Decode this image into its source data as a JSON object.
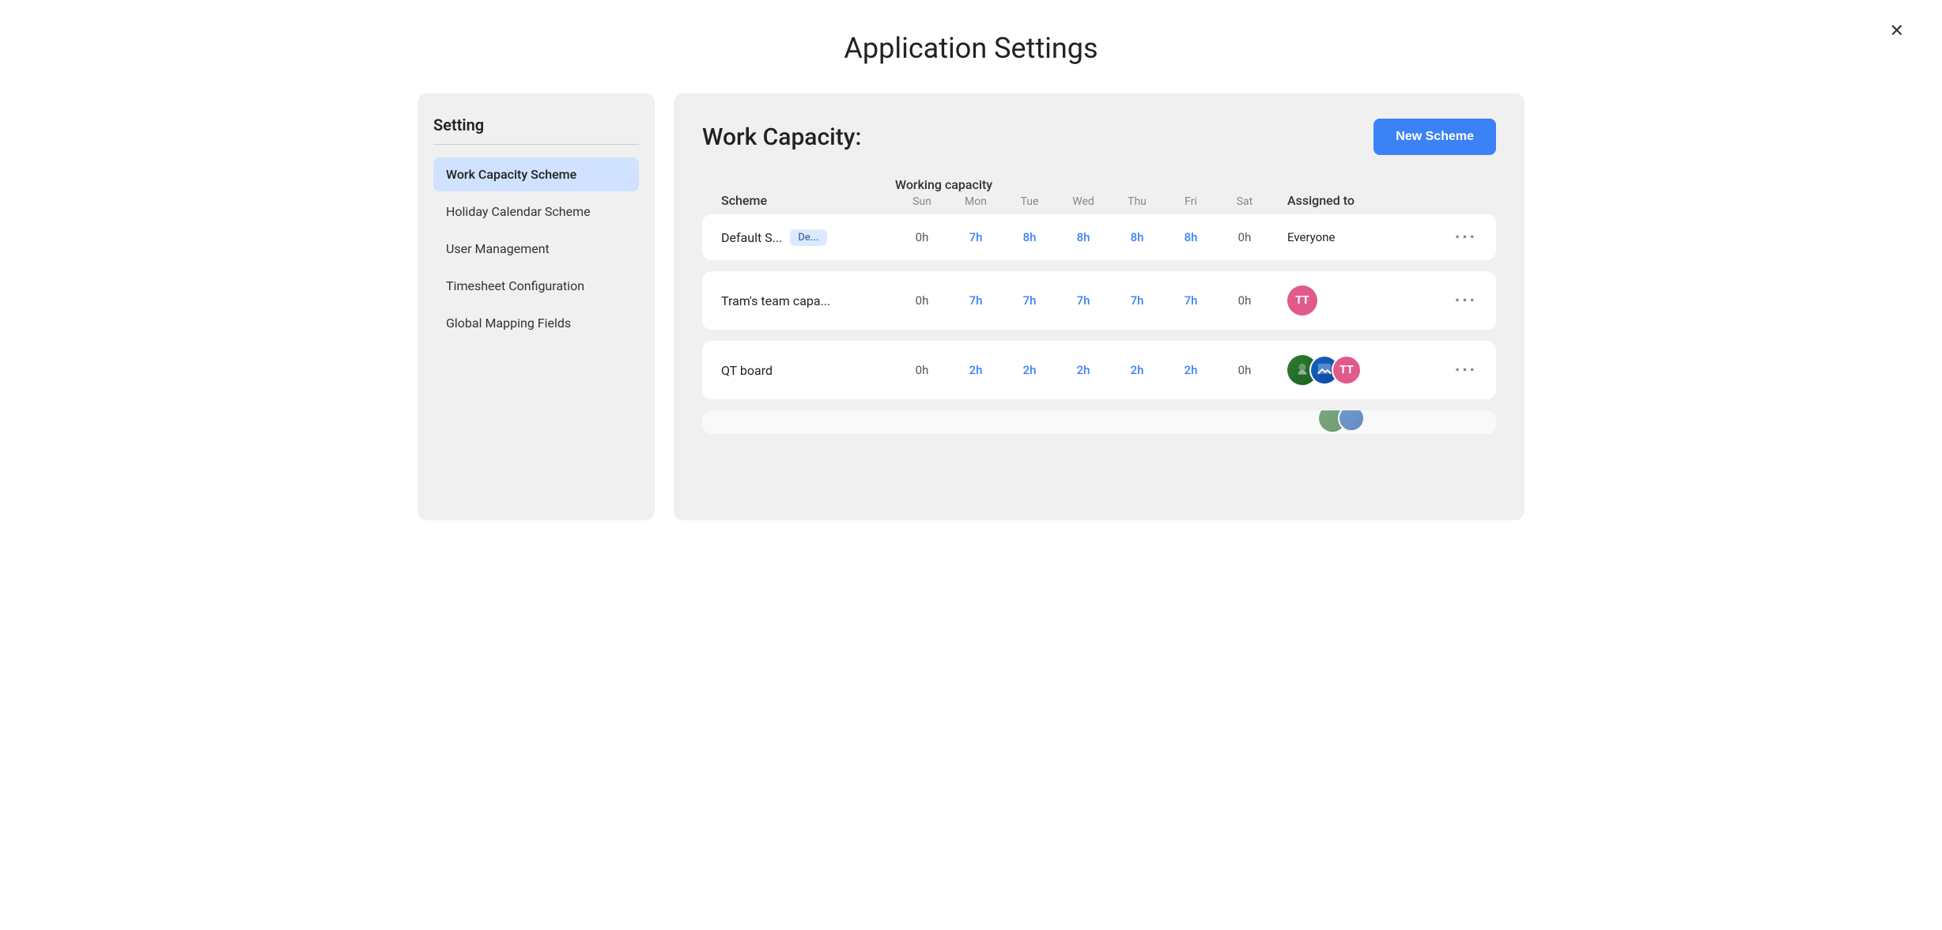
{
  "page": {
    "title": "Application Settings"
  },
  "close_button": "✕",
  "sidebar": {
    "title": "Setting",
    "items": [
      {
        "id": "work-capacity-scheme",
        "label": "Work Capacity Scheme",
        "active": true
      },
      {
        "id": "holiday-calendar-scheme",
        "label": "Holiday Calendar Scheme",
        "active": false
      },
      {
        "id": "user-management",
        "label": "User Management",
        "active": false
      },
      {
        "id": "timesheet-configuration",
        "label": "Timesheet Configuration",
        "active": false
      },
      {
        "id": "global-mapping-fields",
        "label": "Global Mapping Fields",
        "active": false
      }
    ]
  },
  "content": {
    "title": "Work Capacity:",
    "new_scheme_label": "New Scheme",
    "table": {
      "headers": {
        "scheme": "Scheme",
        "working_capacity": "Working capacity",
        "days": [
          "Sun",
          "Mon",
          "Tue",
          "Wed",
          "Thu",
          "Fri",
          "Sat"
        ],
        "assigned_to": "Assigned to"
      },
      "rows": [
        {
          "name": "Default S...",
          "badge": "De...",
          "values": [
            "0h",
            "7h",
            "8h",
            "8h",
            "8h",
            "8h",
            "0h"
          ],
          "zero_indices": [
            0,
            6
          ],
          "assigned_text": "Everyone",
          "avatars": []
        },
        {
          "name": "Tram's team capa...",
          "badge": null,
          "values": [
            "0h",
            "7h",
            "7h",
            "7h",
            "7h",
            "7h",
            "0h"
          ],
          "zero_indices": [
            0,
            6
          ],
          "assigned_text": "",
          "avatars": [
            {
              "type": "tt",
              "label": "TT"
            }
          ]
        },
        {
          "name": "QT board",
          "badge": null,
          "values": [
            "0h",
            "2h",
            "2h",
            "2h",
            "2h",
            "2h",
            "0h"
          ],
          "zero_indices": [
            0,
            6
          ],
          "assigned_text": "",
          "avatars": [
            {
              "type": "nature",
              "label": "🌿"
            },
            {
              "type": "blue",
              "label": "🏞"
            },
            {
              "type": "tt",
              "label": "TT"
            }
          ]
        }
      ]
    }
  }
}
